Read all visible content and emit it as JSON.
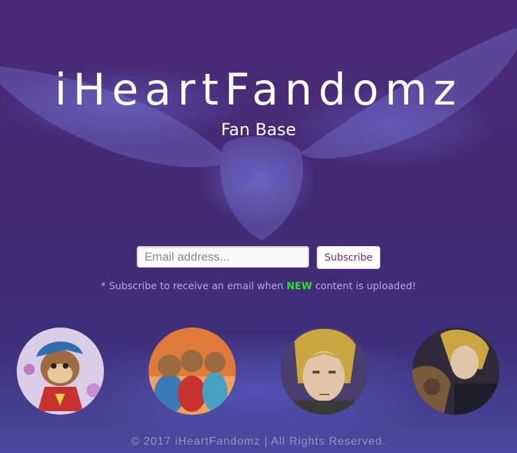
{
  "header": {
    "title": "iHeartFandomz",
    "subtitle": "Fan Base"
  },
  "subscribe_form": {
    "email_placeholder": "Email address...",
    "email_value": "",
    "button_label": "Subscribe"
  },
  "note": {
    "prefix": "* Subscribe to receive an email when ",
    "highlight": "NEW",
    "suffix": " content is uploaded!"
  },
  "footer": {
    "copyright": "© 2017 iHeartFandomz | All Rights Reserved."
  },
  "colors": {
    "background": "#4b2a78",
    "highlight_green": "#2bdc2b",
    "button_text": "#7a2a7a"
  },
  "icons": {
    "background_image": "owl-flying",
    "avatars": [
      "alvin-chipmunk",
      "chipmunks-trio",
      "edward-elric",
      "edward-elric-automail"
    ]
  }
}
